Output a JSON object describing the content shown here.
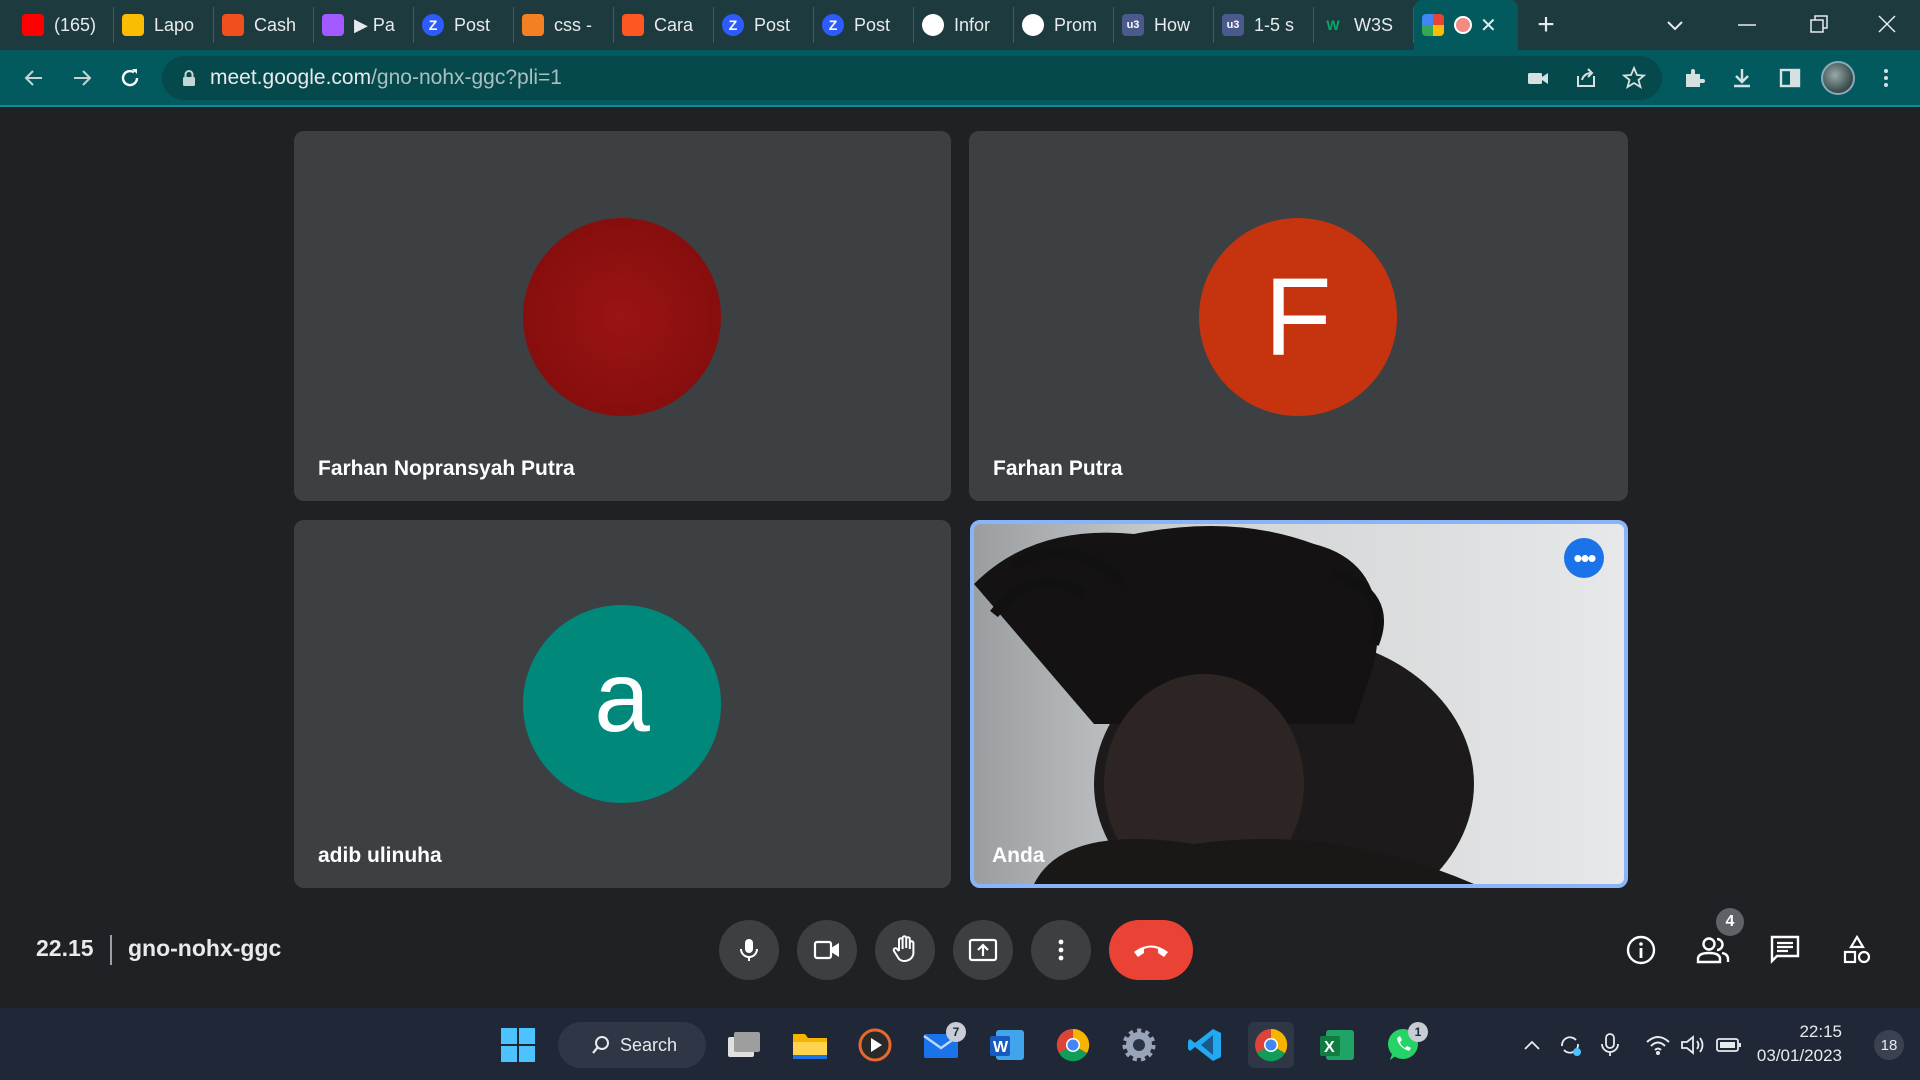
{
  "browser": {
    "tabs": [
      {
        "title": "(165)",
        "icon": "youtube-icon",
        "color": "#ff0000"
      },
      {
        "title": "Lapo",
        "icon": "google-drive-icon",
        "color": "#fbbc04"
      },
      {
        "title": "Cash",
        "icon": "figma-icon",
        "color": "#f24e1e"
      },
      {
        "title": "▶ Pa",
        "icon": "figma-icon",
        "color": "#a259ff"
      },
      {
        "title": "Post",
        "icon": "z-icon",
        "color": "#2d5bff"
      },
      {
        "title": "css -",
        "icon": "stackoverflow-icon",
        "color": "#f48024"
      },
      {
        "title": "Cara",
        "icon": "blogger-icon",
        "color": "#ff5722"
      },
      {
        "title": "Post",
        "icon": "z-icon",
        "color": "#2d5bff"
      },
      {
        "title": "Post",
        "icon": "z-icon",
        "color": "#2d5bff"
      },
      {
        "title": "Infor",
        "icon": "github-icon",
        "color": "#ffffff"
      },
      {
        "title": "Prom",
        "icon": "globe-icon",
        "color": "#ffffff"
      },
      {
        "title": "How",
        "icon": "w3-icon",
        "color": "#4b5a8c"
      },
      {
        "title": "1-5 s",
        "icon": "w3-icon",
        "color": "#4b5a8c"
      },
      {
        "title": "W3S",
        "icon": "w3schools-icon",
        "color": "#04aa6d"
      }
    ],
    "url_host": "meet.google.com",
    "url_path": "/gno-nohx-ggc?pli=1"
  },
  "meeting": {
    "participants": [
      {
        "name": "Farhan Nopransyah Putra",
        "initial": "",
        "color": "#8b1010"
      },
      {
        "name": "Farhan Putra",
        "initial": "F",
        "color": "#c5330f"
      },
      {
        "name": "adib ulinuha",
        "initial": "a",
        "color": "#00897b"
      },
      {
        "name": "Anda",
        "initial": "",
        "color": ""
      }
    ],
    "time": "22.15",
    "code": "gno-nohx-ggc",
    "people_count": "4"
  },
  "taskbar": {
    "search_label": "Search",
    "mail_badge": "7",
    "whatsapp_badge": "1",
    "clock_time": "22:15",
    "clock_date": "03/01/2023",
    "notification_count": "18"
  }
}
